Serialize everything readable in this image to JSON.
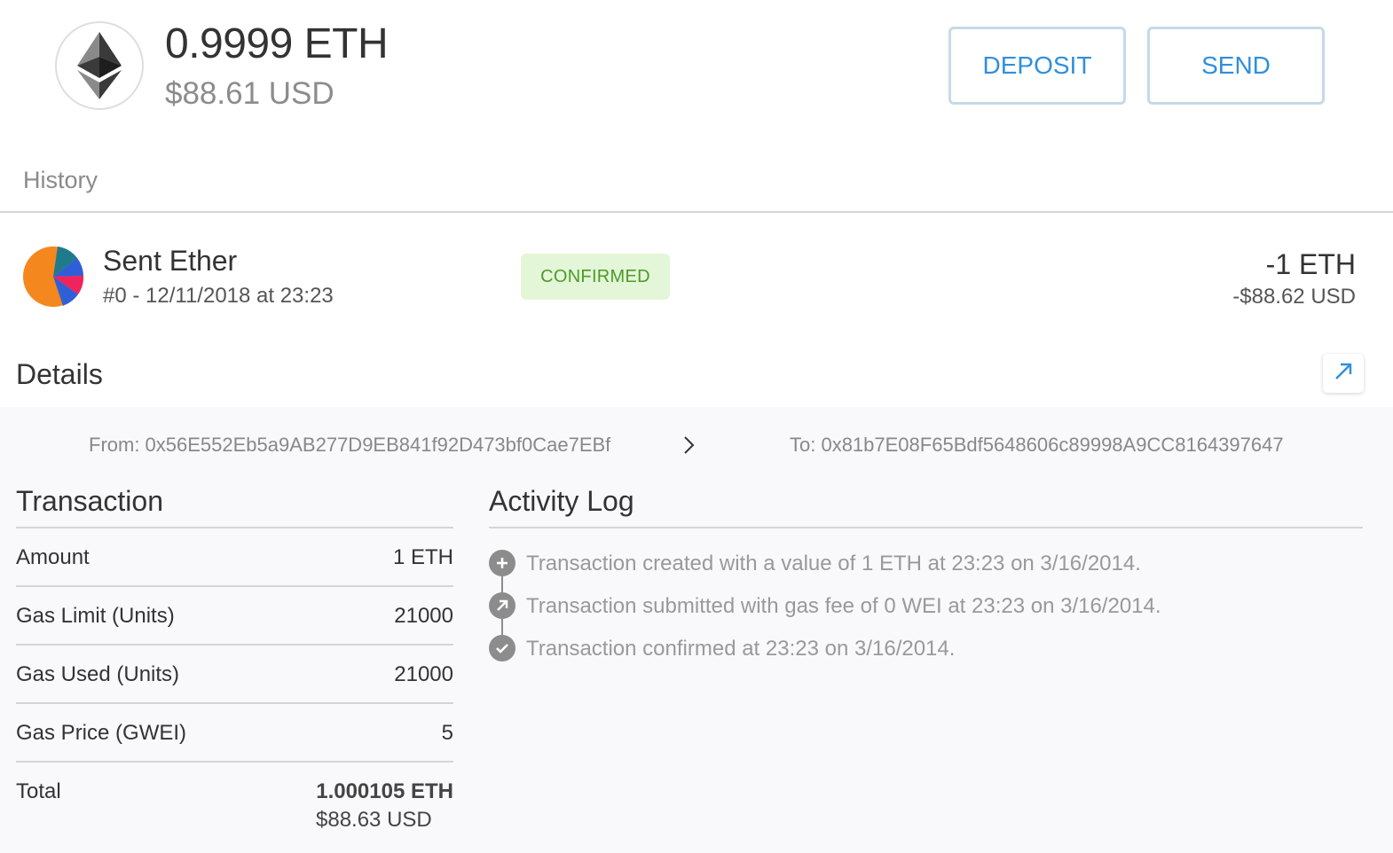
{
  "balance": {
    "eth": "0.9999 ETH",
    "usd": "$88.61 USD",
    "icon": "ethereum-icon"
  },
  "actions": {
    "deposit_label": "DEPOSIT",
    "send_label": "SEND"
  },
  "history": {
    "title": "History"
  },
  "transaction": {
    "title": "Sent Ether",
    "subtitle": "#0 - 12/11/2018 at 23:23",
    "status": "CONFIRMED",
    "amount": "-1 ETH",
    "amount_usd": "-$88.62 USD",
    "status_color": "#4d9a2a"
  },
  "details": {
    "title": "Details",
    "from": "From: 0x56E552Eb5a9AB277D9EB841f92D473bf0Cae7EBf",
    "to": "To: 0x81b7E08F65Bdf5648606c89998A9CC8164397647",
    "external_icon": "external-link-icon"
  },
  "tx_table": {
    "title": "Transaction",
    "rows": [
      {
        "label": "Amount",
        "value": "1 ETH"
      },
      {
        "label": "Gas Limit (Units)",
        "value": "21000"
      },
      {
        "label": "Gas Used (Units)",
        "value": "21000"
      },
      {
        "label": "Gas Price (GWEI)",
        "value": "5"
      }
    ],
    "total_label": "Total",
    "total_eth": "1.000105 ETH",
    "total_usd": "$88.63 USD"
  },
  "activity_log": {
    "title": "Activity Log",
    "items": [
      {
        "icon": "plus-icon",
        "text": "Transaction created with a value of 1 ETH at 23:23 on 3/16/2014."
      },
      {
        "icon": "submit-arrow-icon",
        "text": "Transaction submitted with gas fee of 0 WEI at 23:23 on 3/16/2014."
      },
      {
        "icon": "check-icon",
        "text": "Transaction confirmed at 23:23 on 3/16/2014."
      }
    ]
  },
  "colors": {
    "accent": "#2f8fdd",
    "badge_bg": "#e3f6d8"
  }
}
